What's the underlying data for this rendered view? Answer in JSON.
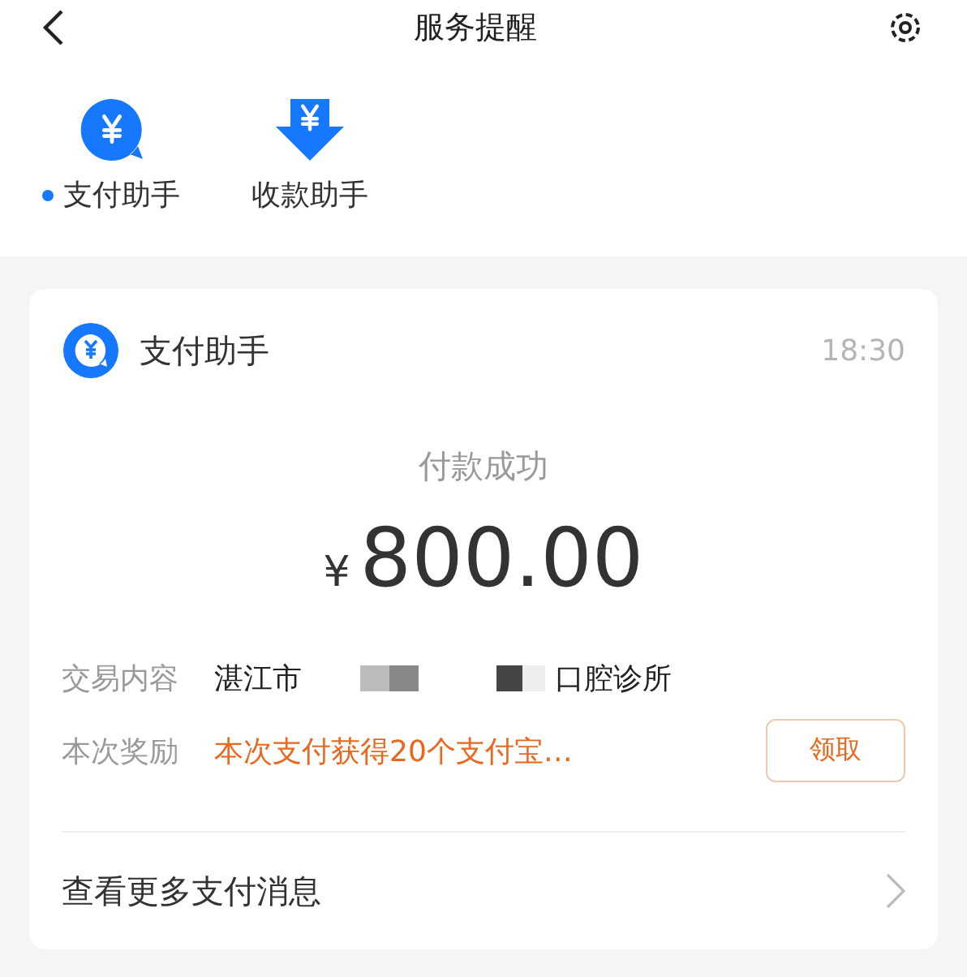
{
  "header": {
    "title": "服务提醒"
  },
  "tabs": [
    {
      "label": "支付助手",
      "selected": true,
      "kind": "bubble"
    },
    {
      "label": "收款助手",
      "selected": false,
      "kind": "arrow"
    }
  ],
  "card": {
    "source": "支付助手",
    "time": "18:30",
    "status": "付款成功",
    "currency": "¥",
    "amount": "800.00",
    "rows": [
      {
        "label": "交易内容",
        "kind": "merchant",
        "value_start": "湛江市",
        "value_end": "口腔诊所"
      },
      {
        "label": "本次奖励",
        "kind": "reward",
        "value": "本次支付获得20个支付宝…",
        "button": "领取"
      }
    ],
    "footer_link": "查看更多支付消息"
  }
}
